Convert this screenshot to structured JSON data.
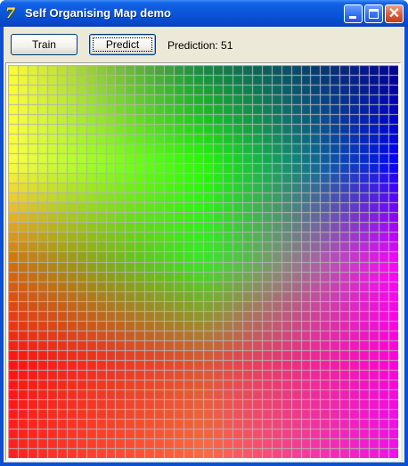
{
  "window": {
    "title": "Self Organising Map demo",
    "app_icon_glyph": "7",
    "minimize_icon": "minimize-icon",
    "maximize_icon": "maximize-icon",
    "close_icon": "close-icon",
    "close_glyph": "✕"
  },
  "toolbar": {
    "train_label": "Train",
    "predict_label": "Predict",
    "status_text": "Prediction: 51"
  },
  "som_map": {
    "rows": 40,
    "cols": 40,
    "gridline_color": "#b4b4b4",
    "color_anchors": {
      "top_left": "#ffff33",
      "top_center": "#118844",
      "top_right": "#000090",
      "upper_left": "#ffff40",
      "center": "#22ff00",
      "upper_right": "#0000ff",
      "middle_left": "#d07010",
      "middle_center": "#30ee20",
      "middle_right": "#ff00ff",
      "lower_left": "#ff1010",
      "lower_center": "#dd5530",
      "lower_right": "#ff00dd",
      "bottom_left": "#ff2020",
      "bottom_center": "#ff6a40",
      "bottom_right": "#ee10ee"
    }
  }
}
